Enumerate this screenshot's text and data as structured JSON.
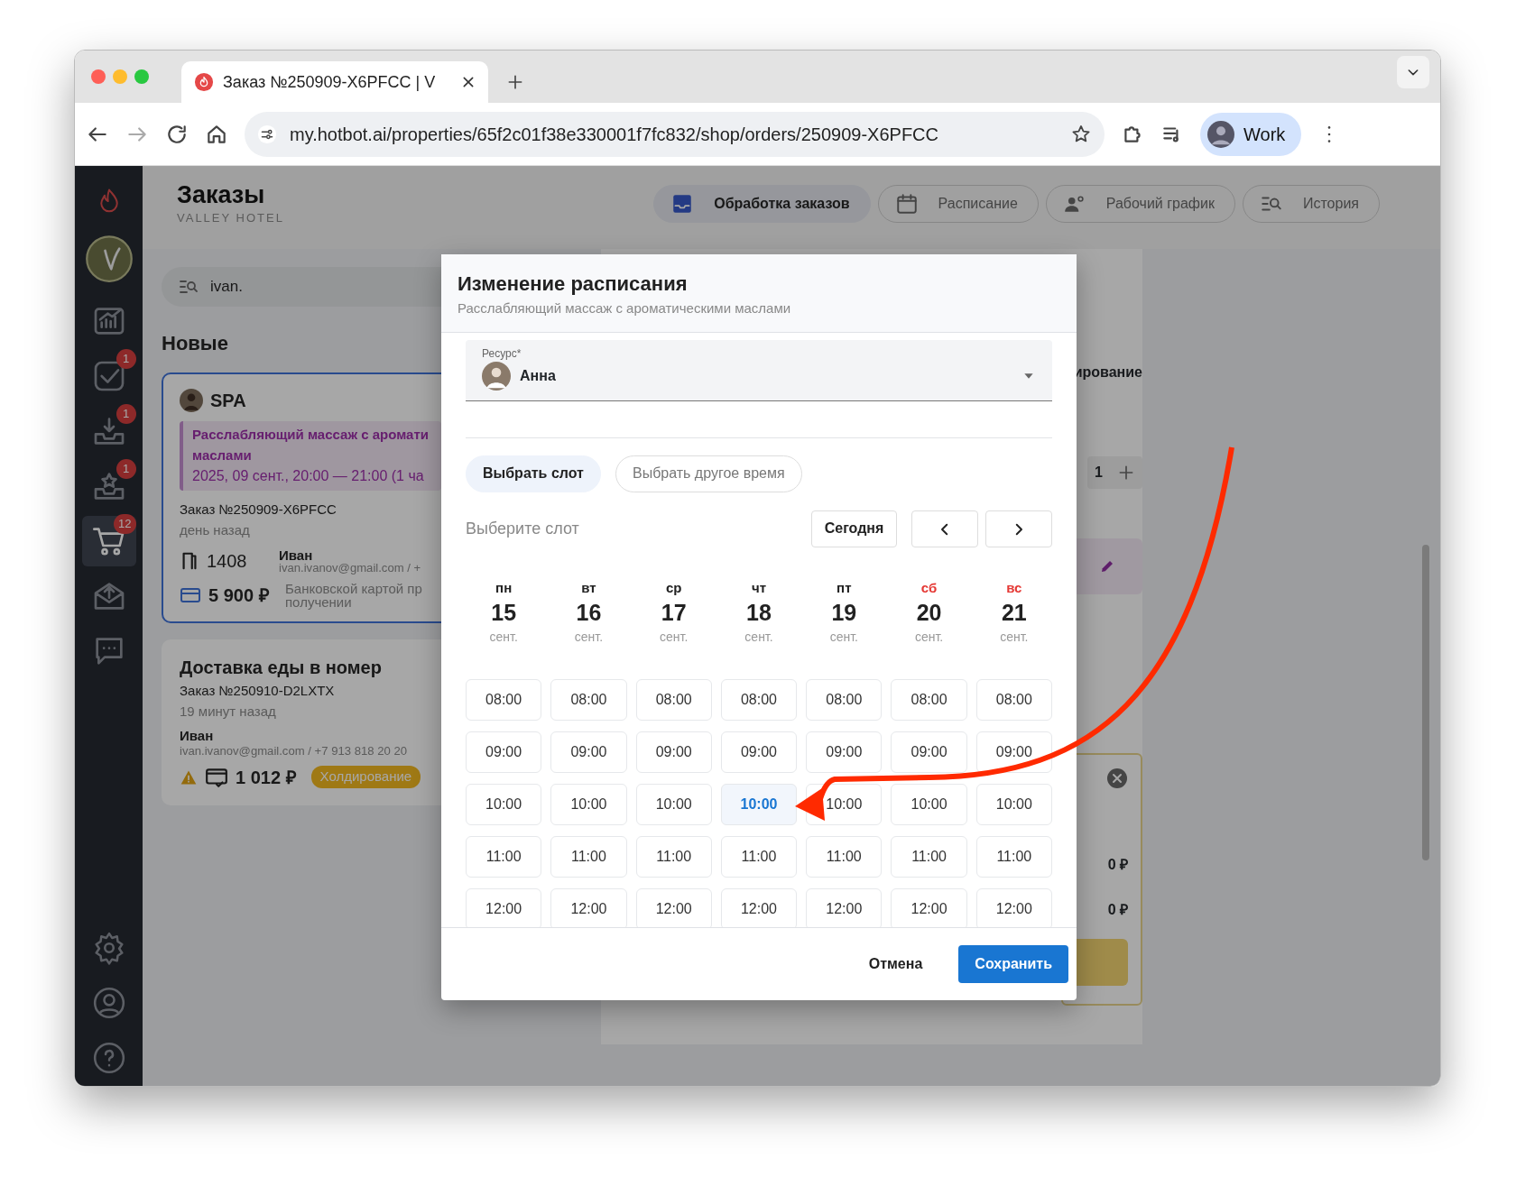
{
  "browser": {
    "tab_title": "Заказ №250909-X6PFCC | V",
    "url": "my.hotbot.ai/properties/65f2c01f38e330001f7fc832/shop/orders/250909-X6PFCC",
    "profile": "Work"
  },
  "sidebar": {
    "items": [
      {
        "kind": "chart",
        "selected": false
      },
      {
        "kind": "check",
        "badge": "1",
        "selected": false
      },
      {
        "kind": "download",
        "badge": "1",
        "selected": false
      },
      {
        "kind": "star",
        "badge": "1",
        "selected": false
      },
      {
        "kind": "cart",
        "badge": "12",
        "selected": true
      },
      {
        "kind": "upload",
        "selected": false
      },
      {
        "kind": "chat",
        "selected": false
      }
    ],
    "bottom_items": [
      {
        "kind": "gear"
      },
      {
        "kind": "user"
      },
      {
        "kind": "help"
      }
    ]
  },
  "header": {
    "title": "Заказы",
    "subtitle": "VALLEY HOTEL"
  },
  "nav_tabs": [
    {
      "label": "Обработка заказов",
      "kind": "inbox",
      "selected": true
    },
    {
      "label": "Расписание",
      "kind": "calendar",
      "selected": false
    },
    {
      "label": "Рабочий график",
      "kind": "staff",
      "selected": false
    },
    {
      "label": "История",
      "kind": "history",
      "selected": false
    }
  ],
  "search": {
    "value": "ivan."
  },
  "section_title": "Новые",
  "orders": [
    {
      "kind": "booking",
      "selected": true,
      "category": "SPA",
      "service": [
        "Расслабляющий массаж с аромати",
        "маслами"
      ],
      "time": "2025, 09 сент., 20:00 — 21:00  (1 ча",
      "number": "Заказ №250909-X6PFCC",
      "age": "день назад",
      "room": "1408",
      "guest": "Иван",
      "contact": "ivan.ivanov@gmail.com / +",
      "amount": "5 900 ₽",
      "payment": [
        "Банковской картой пр",
        "получении"
      ]
    },
    {
      "kind": "delivery",
      "selected": false,
      "title": "Доставка еды в номер",
      "number": "Заказ №250910-D2LXTX",
      "age": "19 минут назад",
      "guest": "Иван",
      "contact": "ivan.ivanov@gmail.com / +7 913 818 20 20",
      "amount": "1 012 ₽",
      "status": "Холдирование"
    }
  ],
  "details_panel": {
    "heading": "ирование",
    "quantity": "1",
    "totals": [
      "0 ₽",
      "0 ₽"
    ]
  },
  "modal": {
    "title": "Изменение расписания",
    "subtitle": "Расслабляющий массаж с ароматическими маслами",
    "resource": {
      "label": "Ресурс*",
      "value": "Анна"
    },
    "modes": [
      {
        "label": "Выбрать слот",
        "selected": true
      },
      {
        "label": "Выбрать другое время",
        "selected": false
      }
    ],
    "slot_label": "Выберите слот",
    "today_button": "Сегодня",
    "days": [
      {
        "weekday": "пн",
        "day": "15",
        "month": "сент.",
        "weekend": false,
        "slots": [
          {
            "time": "08:00",
            "selected": false
          },
          {
            "time": "09:00",
            "selected": false
          },
          {
            "time": "10:00",
            "selected": false
          },
          {
            "time": "11:00",
            "selected": false
          },
          {
            "time": "12:00",
            "selected": false
          }
        ]
      },
      {
        "weekday": "вт",
        "day": "16",
        "month": "сент.",
        "weekend": false,
        "slots": [
          {
            "time": "08:00",
            "selected": false
          },
          {
            "time": "09:00",
            "selected": false
          },
          {
            "time": "10:00",
            "selected": false
          },
          {
            "time": "11:00",
            "selected": false
          },
          {
            "time": "12:00",
            "selected": false
          }
        ]
      },
      {
        "weekday": "ср",
        "day": "17",
        "month": "сент.",
        "weekend": false,
        "slots": [
          {
            "time": "08:00",
            "selected": false
          },
          {
            "time": "09:00",
            "selected": false
          },
          {
            "time": "10:00",
            "selected": false
          },
          {
            "time": "11:00",
            "selected": false
          },
          {
            "time": "12:00",
            "selected": false
          }
        ]
      },
      {
        "weekday": "чт",
        "day": "18",
        "month": "сент.",
        "weekend": false,
        "slots": [
          {
            "time": "08:00",
            "selected": false
          },
          {
            "time": "09:00",
            "selected": false
          },
          {
            "time": "10:00",
            "selected": true
          },
          {
            "time": "11:00",
            "selected": false
          },
          {
            "time": "12:00",
            "selected": false
          }
        ]
      },
      {
        "weekday": "пт",
        "day": "19",
        "month": "сент.",
        "weekend": false,
        "slots": [
          {
            "time": "08:00",
            "selected": false
          },
          {
            "time": "09:00",
            "selected": false
          },
          {
            "time": "10:00",
            "selected": false
          },
          {
            "time": "11:00",
            "selected": false
          },
          {
            "time": "12:00",
            "selected": false
          }
        ]
      },
      {
        "weekday": "сб",
        "day": "20",
        "month": "сент.",
        "weekend": true,
        "slots": [
          {
            "time": "08:00",
            "selected": false
          },
          {
            "time": "09:00",
            "selected": false
          },
          {
            "time": "10:00",
            "selected": false
          },
          {
            "time": "11:00",
            "selected": false
          },
          {
            "time": "12:00",
            "selected": false
          }
        ]
      },
      {
        "weekday": "вс",
        "day": "21",
        "month": "сент.",
        "weekend": true,
        "slots": [
          {
            "time": "08:00",
            "selected": false
          },
          {
            "time": "09:00",
            "selected": false
          },
          {
            "time": "10:00",
            "selected": false
          },
          {
            "time": "11:00",
            "selected": false
          },
          {
            "time": "12:00",
            "selected": false
          }
        ]
      }
    ],
    "cancel": "Отмена",
    "save": "Сохранить"
  }
}
